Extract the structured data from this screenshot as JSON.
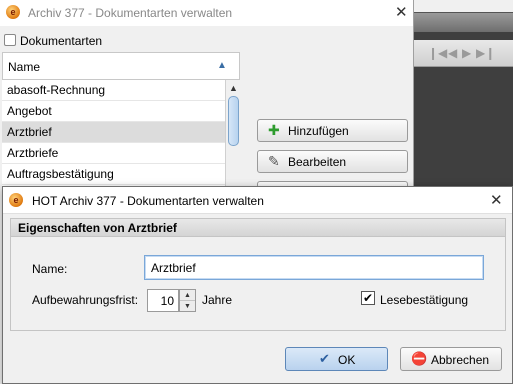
{
  "back_dialog": {
    "title": "Archiv 377 - Dokumentarten verwalten",
    "checkbox_label": "Dokumentarten",
    "column_header": "Name",
    "rows": [
      "abasoft-Rechnung",
      "Angebot",
      "Arztbrief",
      "Arztbriefe",
      "Auftragsbestätigung"
    ],
    "selected_row": "Arztbrief",
    "buttons": {
      "add": "Hinzufügen",
      "edit": "Bearbeiten"
    }
  },
  "front_dialog": {
    "title": "HOT Archiv 377 - Dokumentarten verwalten",
    "section_title": "Eigenschaften von Arztbrief",
    "name_label": "Name:",
    "name_value": "Arztbrief",
    "retention_label": "Aufbewahrungsfrist:",
    "retention_value": "10",
    "retention_unit": "Jahre",
    "read_confirmation_label": "Lesebestätigung",
    "read_confirmation_checked": true,
    "ok_label": "OK",
    "cancel_label": "Abbrechen"
  },
  "icons": {
    "app": "archive-app-icon",
    "close": "close-icon",
    "add": "plus-icon",
    "edit": "edit-icon",
    "ok": "checkmark-icon",
    "cancel": "cancel-icon",
    "sort": "sort-ascending-icon",
    "nav": [
      "first-page-icon",
      "prev-icon",
      "next-icon",
      "last-page-icon"
    ]
  },
  "colors": {
    "accent": "#3a6ea5",
    "add_icon": "#2e9c2e",
    "cancel_icon": "#cc2222",
    "selection": "#dcdcdc"
  }
}
